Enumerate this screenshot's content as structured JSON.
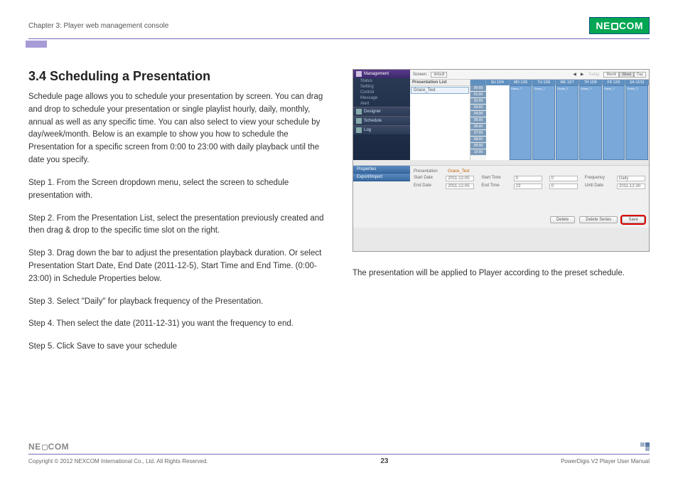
{
  "header": {
    "chapter": "Chapter 3: Player web management console",
    "logo_text": "NEXCOM"
  },
  "title": "3.4 Scheduling a Presentation",
  "intro": "Schedule page allows you to schedule your presentation by screen. You can drag and drop to schedule your presentation or single playlist hourly, daily, monthly, annual as well as any specific time. You can also select to view your schedule by day/week/month. Below is an example to show you how to schedule the Presentation for a specific screen from 0:00 to 23:00 with daily playback until the date you specify.",
  "steps": [
    "Step 1. From the Screen dropdown menu, select the screen to schedule presentation with.",
    "Step 2. From the Presentation List, select the presentation previously created and then drag & drop to the specific time slot on the right.",
    "Step 3. Drag down the bar to adjust the presentation playback duration. Or select Presentation Start Date, End Date (2011-12-5), Start Time and End Time. (0:00-23:00) in Schedule Properties below.",
    "Step 3. Select \"Daily\" for playback frequency of the Presentation.",
    "Step 4. Then select the date (2011-12-31) you want the frequency to end.",
    "Step 5. Click Save to save your schedule"
  ],
  "caption": "The presentation will be applied to Player according to the preset schedule.",
  "screenshot": {
    "sidebar": {
      "main": "Management",
      "items": [
        "Status",
        "Setting",
        "Control",
        "Message",
        "Alert"
      ],
      "tabs": [
        "Designer",
        "Schedule",
        "Log"
      ]
    },
    "topbar": {
      "screen_label": "Screen :",
      "screen_value": "default",
      "today": "Today",
      "view_modes": [
        "Month",
        "Week",
        "Day"
      ],
      "active_mode": "Week"
    },
    "presentation_list": {
      "header": "Presentation List",
      "items": [
        "Grace_Test"
      ]
    },
    "calendar": {
      "days": [
        "SU 12/4",
        "MO 12/5",
        "TU 12/6",
        "WE 12/7",
        "TH 12/8",
        "FR 12/9",
        "SA 12/10"
      ],
      "times": [
        "00:00",
        "01:00",
        "02:00",
        "03:00",
        "04:00",
        "05:00",
        "06:00",
        "07:00",
        "08:00",
        "09:00",
        "10:00"
      ],
      "event_label": "Grace_T"
    },
    "properties": {
      "tabs": [
        "Properties",
        "Export/Import"
      ],
      "presentation_label": "Presentation",
      "presentation_value": "Grace_Test",
      "start_date_label": "Start Date",
      "start_date_value": "2011-12-05",
      "end_date_label": "End Date",
      "end_date_value": "2011-12-05",
      "start_time_label": "Start Time",
      "start_time_h": "0",
      "start_time_m": "0",
      "end_time_label": "End Time",
      "end_time_h": "23",
      "end_time_m": "0",
      "frequency_label": "Frequency",
      "frequency_value": "Daily",
      "until_label": "Until Date",
      "until_value": "2011-12-30",
      "buttons": {
        "delete": "Delete",
        "delete_series": "Delete Series",
        "save": "Save"
      }
    }
  },
  "footer": {
    "logo_text": "NEXCOM",
    "copyright": "Copyright © 2012 NEXCOM International Co., Ltd. All Rights Reserved.",
    "page": "23",
    "manual": "PowerDigis V2 Player User Manual"
  }
}
